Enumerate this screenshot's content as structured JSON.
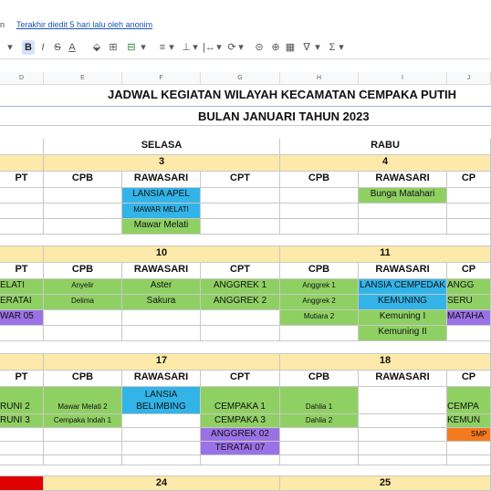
{
  "topbar": {
    "left_text": "n",
    "last_edit": "Terakhir diedit 5 hari lalu oleh anonim"
  },
  "toolbar": {
    "items": [
      "▾",
      "B",
      "I",
      "S",
      "A",
      "⬙",
      "⊞",
      "⊟",
      "▾",
      "≡",
      "▾",
      "⊥",
      "▾",
      "|↔",
      "▾",
      "⟳",
      "▾",
      "⊝",
      "⊕",
      "▦",
      "∇",
      "▾",
      "Σ",
      "▾"
    ]
  },
  "columns": [
    "D",
    "E",
    "F",
    "G",
    "H",
    "I",
    "J"
  ],
  "title1": "JADWAL KEGIATAN WILAYAH KECAMATAN CEMPAKA PUTIH",
  "title2": "BULAN JANUARI TAHUN 2023",
  "days": {
    "selasa": "SELASA",
    "rabu": "RABU"
  },
  "weeks": [
    {
      "tue": "3",
      "wed": "4"
    },
    {
      "tue": "10",
      "wed": "11"
    },
    {
      "tue": "17",
      "wed": "18"
    },
    {
      "tue": "24",
      "wed": "25"
    }
  ],
  "headers": {
    "cpt": "CPT",
    "cpb": "CPB",
    "rawasari": "RAWASARI",
    "cpt_cut": "PT",
    "cp_cut": "CP"
  },
  "w1": {
    "rawasari": [
      "LANSIA APEL",
      "MAWAR MELATI",
      "Mawar Melati"
    ],
    "wed_rawasari": "Bunga Matahari"
  },
  "w2": {
    "cpt_left": [
      "ELATI",
      "ERATAI",
      "WAR 05"
    ],
    "cpb": [
      "Anyelir",
      "Delima"
    ],
    "rawasari": [
      "Aster",
      "Sakura"
    ],
    "cpt": [
      "ANGGREK 1",
      "ANGGREK 2"
    ],
    "wed_cpb": [
      "Anggrek 1",
      "Anggrek 2",
      "Mutiara 2"
    ],
    "wed_rawasari": [
      "LANSIA CEMPEDAK",
      "KEMUNING",
      "Kemuning I",
      "Kemuning II"
    ],
    "wed_cpt": [
      "ANGG",
      "SERU",
      "MATAHA"
    ]
  },
  "w3": {
    "cpt_left": [
      "RUNI 2",
      "RUNI 3"
    ],
    "cpb": [
      "Mawar Melati 2",
      "Cempaka Indah 1"
    ],
    "rawasari": [
      "LANSIA",
      "BELIMBING"
    ],
    "cpt": [
      "CEMPAKA 1",
      "CEMPAKA 3",
      "ANGGREK 02",
      "TERATAI 07"
    ],
    "wed_cpb": [
      "Dahlia 1",
      "Dahlia 2"
    ],
    "wed_cpt": [
      "CEMPA",
      "KEMUN",
      "SMP"
    ]
  }
}
